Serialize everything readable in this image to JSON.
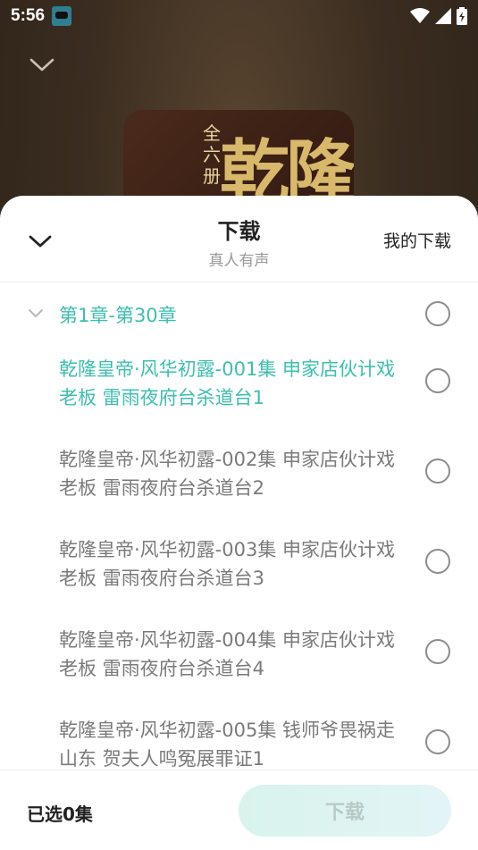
{
  "status_bar": {
    "time": "5:56"
  },
  "album": {
    "cover_title": "乾隆",
    "cover_sub": "全六册"
  },
  "sheet": {
    "title": "下载",
    "subtitle": "真人有声",
    "my_downloads_label": "我的下载"
  },
  "chapter": {
    "label": "第1章-第30章"
  },
  "episodes": [
    {
      "title": "乾隆皇帝·风华初露-001集 申家店伙计戏老板 雷雨夜府台杀道台1",
      "active": true
    },
    {
      "title": "乾隆皇帝·风华初露-002集 申家店伙计戏老板 雷雨夜府台杀道台2",
      "active": false
    },
    {
      "title": "乾隆皇帝·风华初露-003集 申家店伙计戏老板 雷雨夜府台杀道台3",
      "active": false
    },
    {
      "title": "乾隆皇帝·风华初露-004集 申家店伙计戏老板 雷雨夜府台杀道台4",
      "active": false
    },
    {
      "title": "乾隆皇帝·风华初露-005集 钱师爷畏祸走山东 贺夫人鸣冤展罪证1",
      "active": false
    }
  ],
  "footer": {
    "selected_count": "已选0集",
    "download_label": "下载"
  },
  "colors": {
    "accent": "#3cbfae",
    "text_primary": "#222222",
    "text_secondary": "#7a7a7a"
  },
  "icons": {
    "collapse": "chevron-down-icon",
    "chapter_toggle": "chevron-down-icon",
    "select": "radio-circle-icon"
  }
}
